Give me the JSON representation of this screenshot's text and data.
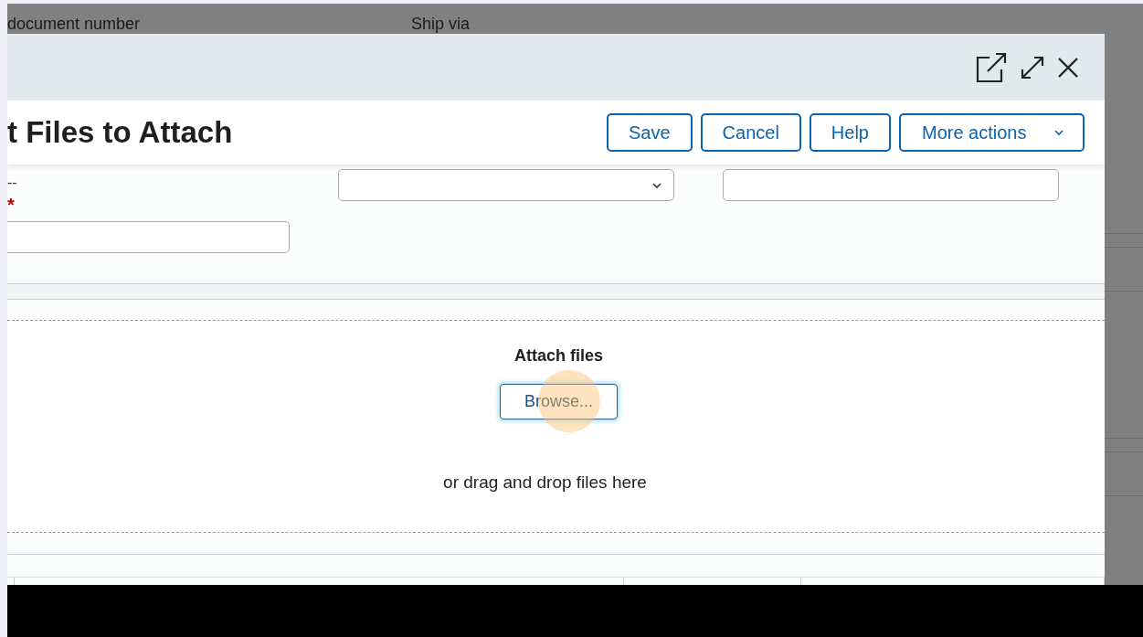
{
  "backdrop": {
    "labels": [
      "document number",
      "Ship via"
    ]
  },
  "dialog": {
    "title": "t Files to Attach",
    "buttons": [
      {
        "label": "Save",
        "kind": "plain"
      },
      {
        "label": "Cancel",
        "kind": "plain"
      },
      {
        "label": "Help",
        "kind": "plain"
      },
      {
        "label": "More actions",
        "kind": "menu"
      }
    ],
    "form": {
      "left_text": "--",
      "required_mark": "*",
      "fields": [
        {
          "kind": "text"
        },
        {
          "kind": "select"
        },
        {
          "kind": "text"
        }
      ]
    },
    "dropzone": {
      "heading": "Attach files",
      "browse_button": "Browse...",
      "hint": "or drag and drop files here"
    }
  }
}
